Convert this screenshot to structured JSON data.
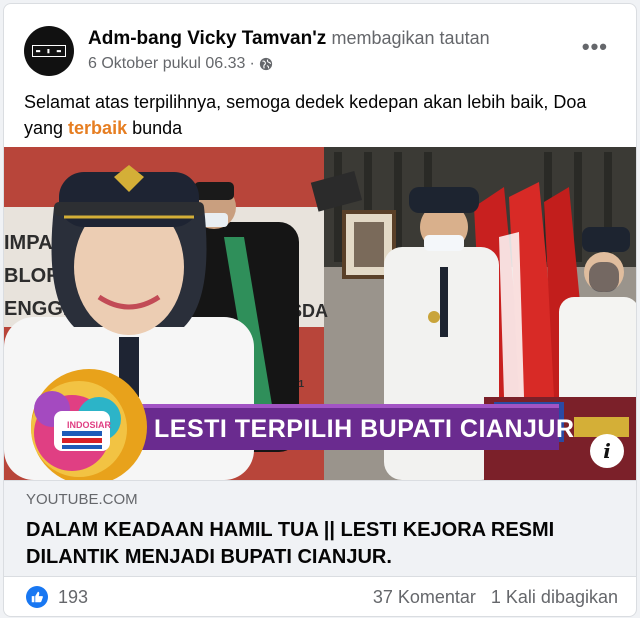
{
  "post": {
    "author": "Adm-bang Vicky Tamvan'z",
    "action": "membagikan tautan",
    "date": "6 Oktober pukul 06.33",
    "separator": "·",
    "more_icon": "more-horizontal-icon",
    "text_part1": "Selamat atas terpilihnya, semoga dedek kedepan akan lebih baik, Doa yang ",
    "text_highlight": "terbaik",
    "text_part2": " bunda",
    "highlight_color": "#e67e22"
  },
  "link": {
    "image_banner": "LESTI TERPILIH BUPATI CIANJUR",
    "logo_label": "INDOSIAR",
    "domain": "YOUTUBE.COM",
    "title": "DALAM KEADAAN HAMIL TUA || LESTI KEJORA RESMI DILANTIK MENJADI BUPATI CIANJUR."
  },
  "stats": {
    "likes": "193",
    "comments": "37 Komentar",
    "shares": "1 Kali dibagikan",
    "like_color": "#1877f2"
  }
}
